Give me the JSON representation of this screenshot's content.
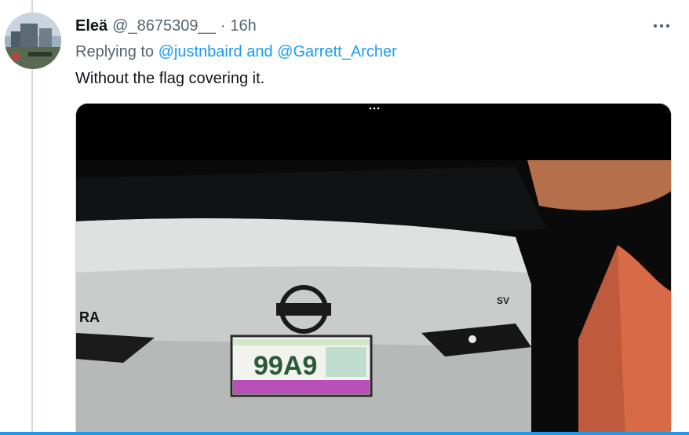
{
  "tweet": {
    "display_name": "Eleä",
    "handle": "@_8675309__",
    "separator": "·",
    "time": "16h",
    "reply_prefix": "Replying to",
    "mentions": [
      "@justnbaird",
      "@Garrett_Archer"
    ],
    "mention_joiner": "and",
    "text": "Without the flag covering it."
  },
  "media": {
    "plate_visible": "99A9",
    "car_badge": "RA",
    "model_badge": "SV"
  },
  "colors": {
    "accent": "#1d9bf0",
    "secondary_text": "#536471",
    "primary_text": "#0f1419",
    "thread_line": "#cfd9de"
  }
}
